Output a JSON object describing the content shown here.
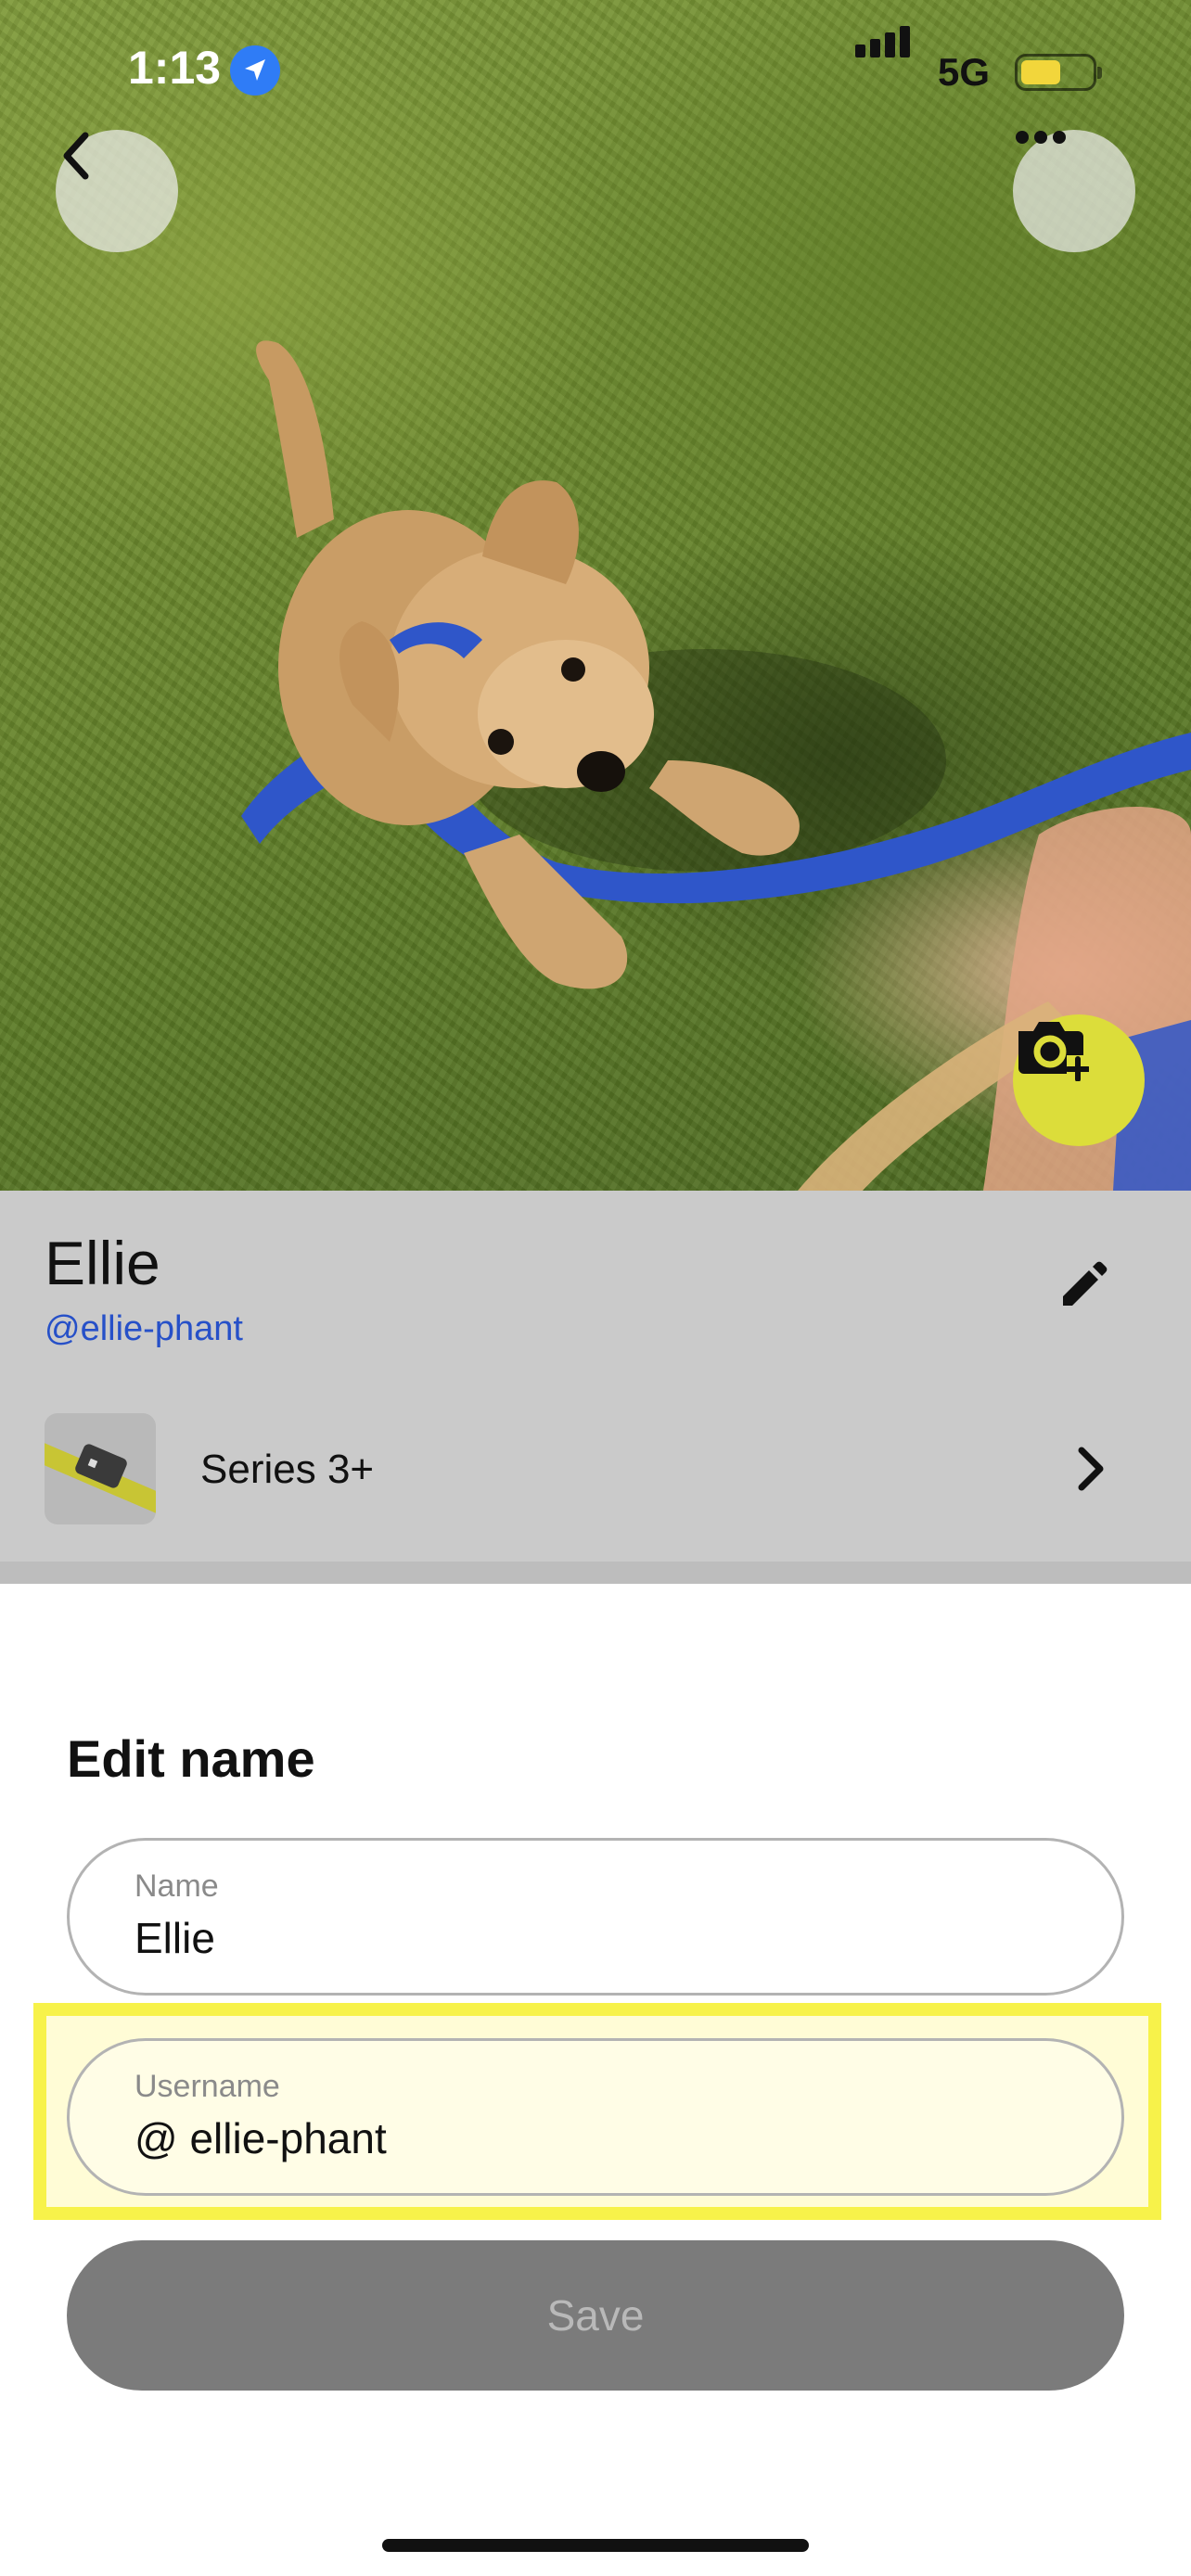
{
  "status_bar": {
    "time": "1:13",
    "network": "5G",
    "location_icon": "location-arrow-icon",
    "signal_icon": "cellular-signal-icon",
    "battery_icon": "battery-icon",
    "battery_fill_fraction": 0.5,
    "battery_color": "#f2d63b"
  },
  "header": {
    "back_icon": "chevron-left-icon",
    "more_icon": "ellipsis-icon",
    "camera_icon": "camera-plus-icon",
    "camera_button_color": "#dcdd3a"
  },
  "profile": {
    "name": "Ellie",
    "handle": "@ellie-phant",
    "edit_icon": "pencil-icon",
    "device_label": "Series 3+",
    "device_chevron": "chevron-right-icon",
    "handle_color": "#2650c8"
  },
  "sheet": {
    "title": "Edit name",
    "name_field": {
      "label": "Name",
      "value": "Ellie"
    },
    "username_field": {
      "label": "Username",
      "value": "@ ellie-phant"
    },
    "save_label": "Save",
    "highlight_color": "#f7f24a"
  }
}
